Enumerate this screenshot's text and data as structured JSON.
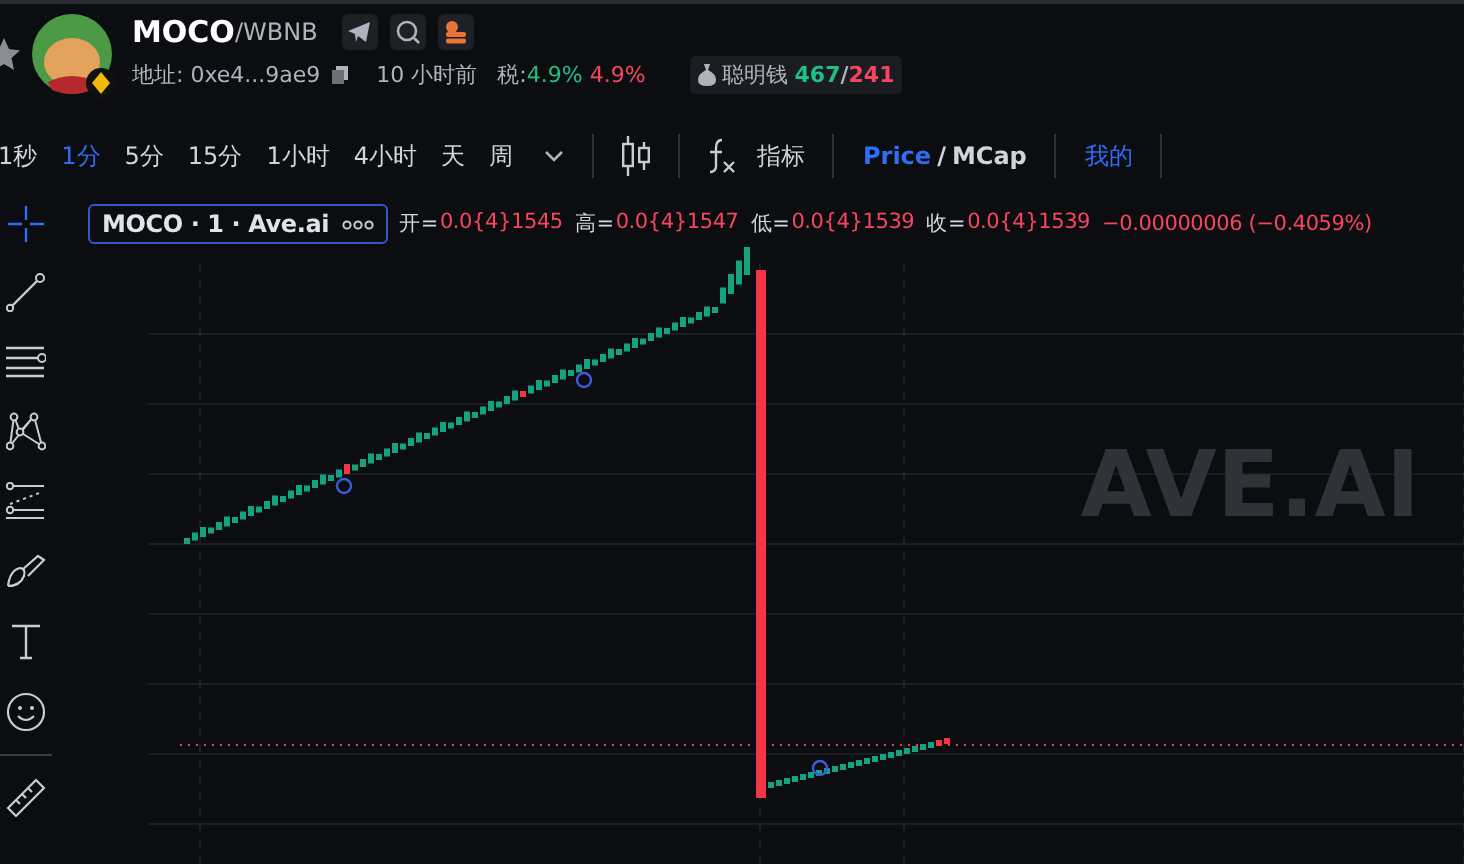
{
  "token": {
    "symbol": "MOCO",
    "pair": "/WBNB",
    "address_label": "地址:",
    "address": "0xe4...9ae9",
    "age": "10 小时前",
    "tax_label": "税:",
    "buy_tax": "4.9%",
    "sell_tax": "4.9%",
    "smart_money_label": "聪明钱",
    "smart_buy": "467",
    "smart_separator": "/",
    "smart_sell": "241"
  },
  "timeframes": [
    {
      "label": "1秒",
      "selected": false
    },
    {
      "label": "1分",
      "selected": true
    },
    {
      "label": "5分",
      "selected": false
    },
    {
      "label": "15分",
      "selected": false
    },
    {
      "label": "1小时",
      "selected": false
    },
    {
      "label": "4小时",
      "selected": false
    },
    {
      "label": "天",
      "selected": false
    },
    {
      "label": "周",
      "selected": false
    }
  ],
  "toolbar": {
    "indicators": "指标",
    "price": "Price",
    "separator": "/",
    "mcap": "MCap",
    "price_selected": true,
    "mine": "我的"
  },
  "legend": {
    "title": "MOCO · 1 · Ave.ai",
    "values": [
      {
        "label": "开=",
        "value": "0.0{4}1545"
      },
      {
        "label": "高=",
        "value": "0.0{4}1547"
      },
      {
        "label": "低=",
        "value": "0.0{4}1539"
      },
      {
        "label": "收=",
        "value": "0.0{4}1539"
      }
    ],
    "change": "−0.00000006 (−0.4059%)"
  },
  "watermark": "AVE.AI"
}
